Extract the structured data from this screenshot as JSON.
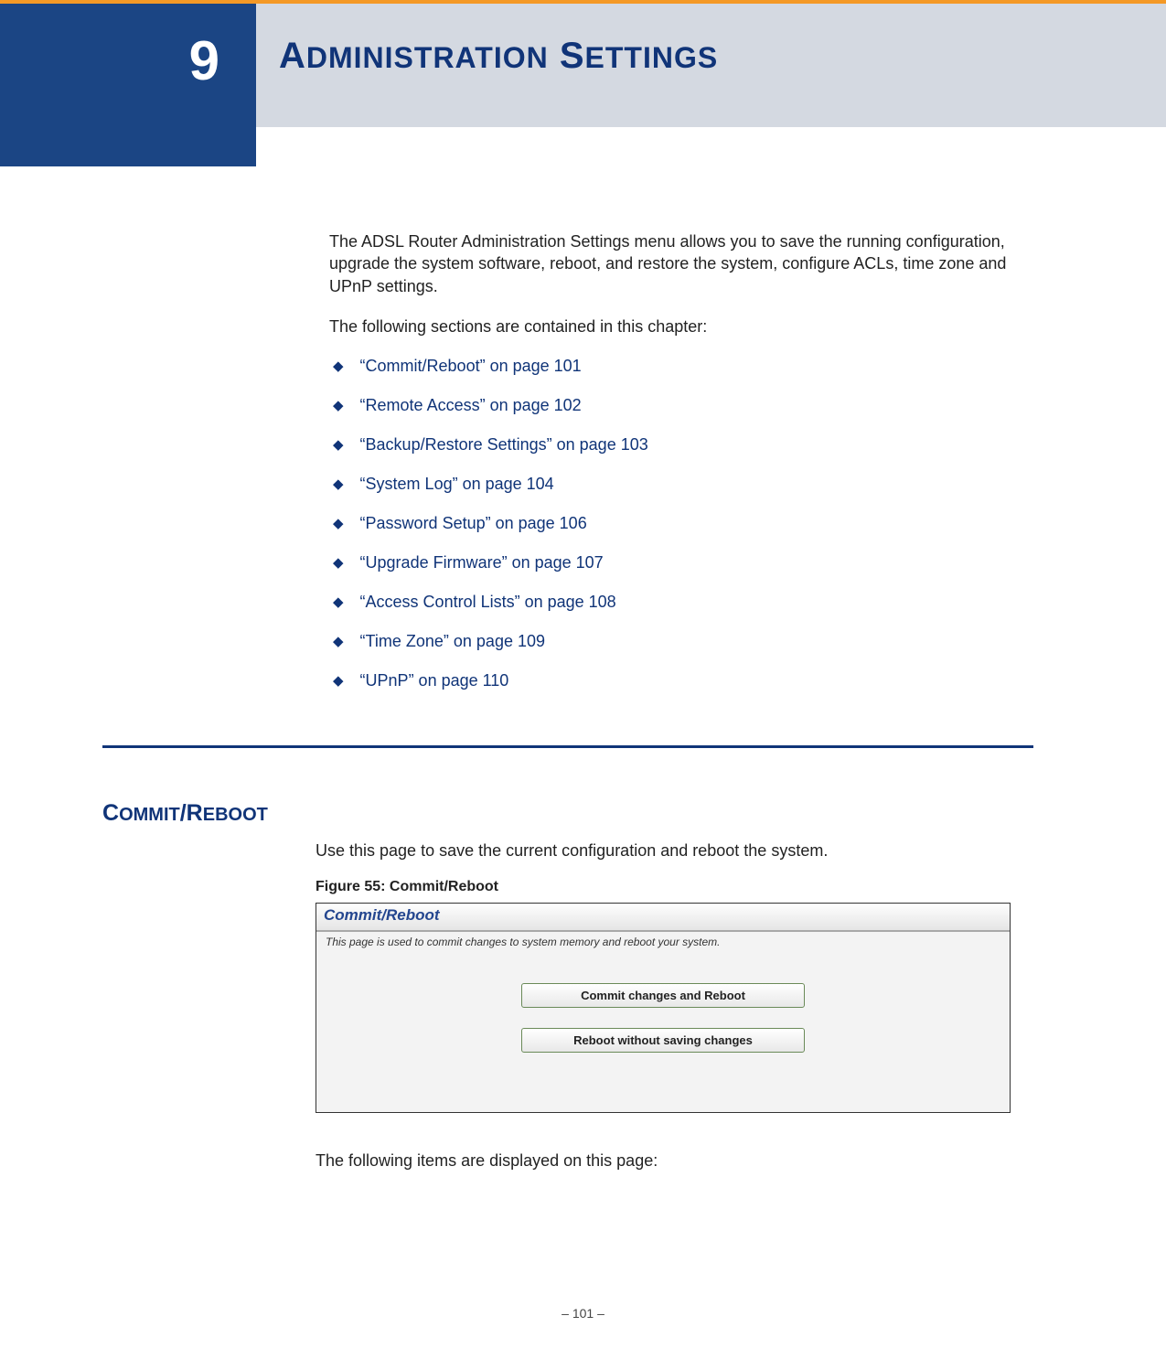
{
  "chapter": {
    "number": "9",
    "title_first": "A",
    "title_rest1": "DMINISTRATION",
    "title_space": " ",
    "title_first2": "S",
    "title_rest2": "ETTINGS"
  },
  "intro": "The ADSL Router Administration Settings menu allows you to save the running configuration, upgrade the system software, reboot, and restore the system, configure ACLs, time zone and UPnP settings.",
  "sections_intro": "The following sections are contained in this chapter:",
  "toc": [
    {
      "label": "“Commit/Reboot” on page 101"
    },
    {
      "label": "“Remote Access” on page 102"
    },
    {
      "label": "“Backup/Restore Settings” on page 103"
    },
    {
      "label": "“System Log” on page 104"
    },
    {
      "label": "“Password Setup” on page 106"
    },
    {
      "label": "“Upgrade Firmware” on page 107"
    },
    {
      "label": "“Access Control Lists” on page 108"
    },
    {
      "label": "“Time Zone” on page 109"
    },
    {
      "label": "“UPnP” on page 110"
    }
  ],
  "section": {
    "heading_c1": "C",
    "heading_r1": "OMMIT",
    "heading_slash": "/",
    "heading_c2": "R",
    "heading_r2": "EBOOT",
    "text": "Use this page to save the current configuration and reboot the system.",
    "figure_caption": "Figure 55:  Commit/Reboot",
    "figure_header": "Commit/Reboot",
    "figure_subtext": "This page is used to commit changes to system memory and reboot your system.",
    "button1": "Commit changes and Reboot",
    "button2": "Reboot without saving changes",
    "after_text": "The following items are displayed on this page:"
  },
  "footer": "–  101  –"
}
